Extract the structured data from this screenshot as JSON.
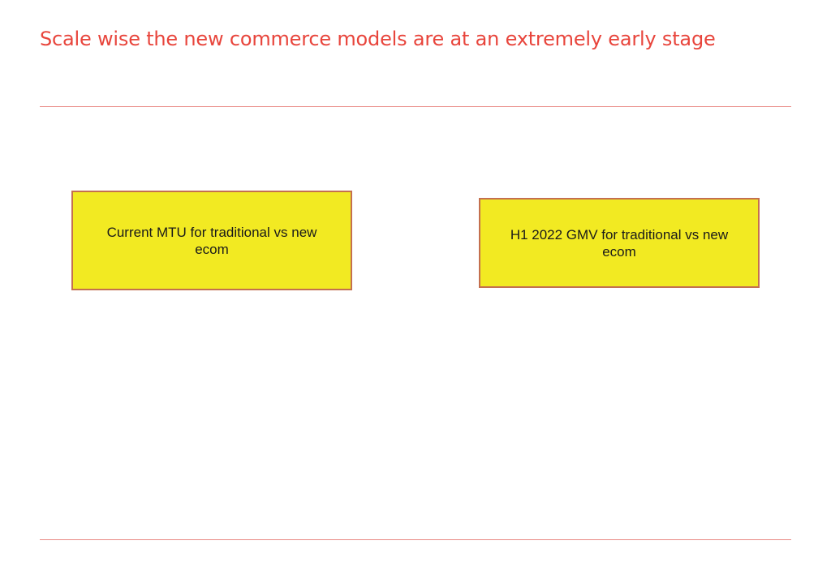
{
  "slide": {
    "title": "Scale wise the new commerce models are at an extremely early stage",
    "boxes": [
      {
        "text": "Current MTU for traditional vs new ecom"
      },
      {
        "text": "H1 2022 GMV for traditional vs new ecom"
      }
    ]
  },
  "colors": {
    "title": "#e8453c",
    "rule": "#e98a85",
    "box_fill": "#f2ea22",
    "box_border": "#c4704f"
  }
}
